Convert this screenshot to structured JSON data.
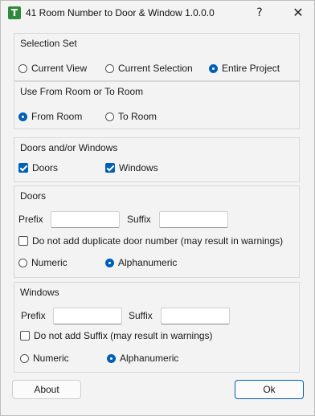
{
  "window": {
    "title": "41 Room Number to Door & Window 1.0.0.0",
    "icon": "T",
    "help": "?",
    "close": "✕"
  },
  "selection_set": {
    "label": "Selection Set",
    "options": [
      "Current View",
      "Current Selection",
      "Entire Project"
    ],
    "selected": "Entire Project"
  },
  "room_direction": {
    "label": "Use From Room or To Room",
    "options": [
      "From Room",
      "To Room"
    ],
    "selected": "From Room"
  },
  "doors_windows": {
    "label": "Doors and/or Windows",
    "doors": {
      "label": "Doors",
      "checked": true
    },
    "windows": {
      "label": "Windows",
      "checked": true
    }
  },
  "doors": {
    "label": "Doors",
    "prefix_label": "Prefix",
    "prefix_value": "",
    "suffix_label": "Suffix",
    "suffix_value": "",
    "no_duplicate_label": "Do not add duplicate door number (may result in warnings)",
    "no_duplicate_checked": false,
    "numeric_label": "Numeric",
    "alpha_label": "Alphanumeric",
    "selected": "Alphanumeric"
  },
  "windows": {
    "label": "Windows",
    "prefix_label": "Prefix",
    "prefix_value": "",
    "suffix_label": "Suffix",
    "suffix_value": "",
    "no_suffix_label": "Do not add Suffix (may result in warnings)",
    "no_suffix_checked": false,
    "numeric_label": "Numeric",
    "alpha_label": "Alphanumeric",
    "selected": "Alphanumeric"
  },
  "footer": {
    "about_label": "About",
    "ok_label": "Ok"
  },
  "colors": {
    "accent": "#005fb8",
    "background": "#f3f3f3"
  }
}
